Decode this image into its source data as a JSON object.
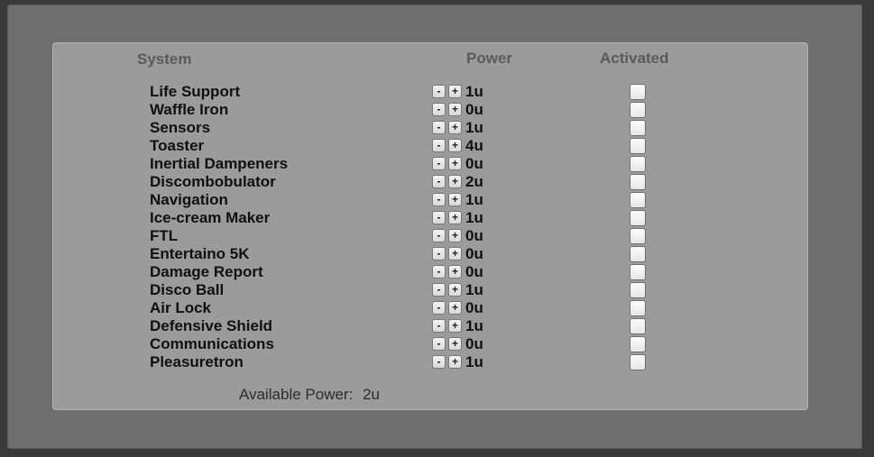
{
  "headers": {
    "system": "System",
    "power": "Power",
    "activated": "Activated"
  },
  "buttons": {
    "minus": "-",
    "plus": "+"
  },
  "systems": [
    {
      "name": "Life Support",
      "power": "1u",
      "activated": false
    },
    {
      "name": "Waffle Iron",
      "power": "0u",
      "activated": false
    },
    {
      "name": "Sensors",
      "power": "1u",
      "activated": false
    },
    {
      "name": "Toaster",
      "power": "4u",
      "activated": false
    },
    {
      "name": "Inertial Dampeners",
      "power": "0u",
      "activated": false
    },
    {
      "name": "Discombobulator",
      "power": "2u",
      "activated": false
    },
    {
      "name": "Navigation",
      "power": "1u",
      "activated": false
    },
    {
      "name": "Ice-cream Maker",
      "power": "1u",
      "activated": false
    },
    {
      "name": "FTL",
      "power": "0u",
      "activated": false
    },
    {
      "name": "Entertaino 5K",
      "power": "0u",
      "activated": false
    },
    {
      "name": "Damage Report",
      "power": "0u",
      "activated": false
    },
    {
      "name": "Disco Ball",
      "power": "1u",
      "activated": false
    },
    {
      "name": "Air Lock",
      "power": "0u",
      "activated": false
    },
    {
      "name": "Defensive Shield",
      "power": "1u",
      "activated": false
    },
    {
      "name": "Communications",
      "power": "0u",
      "activated": false
    },
    {
      "name": "Pleasuretron",
      "power": "1u",
      "activated": false
    }
  ],
  "footer": {
    "available_label": "Available Power:",
    "available_value": "2u"
  }
}
